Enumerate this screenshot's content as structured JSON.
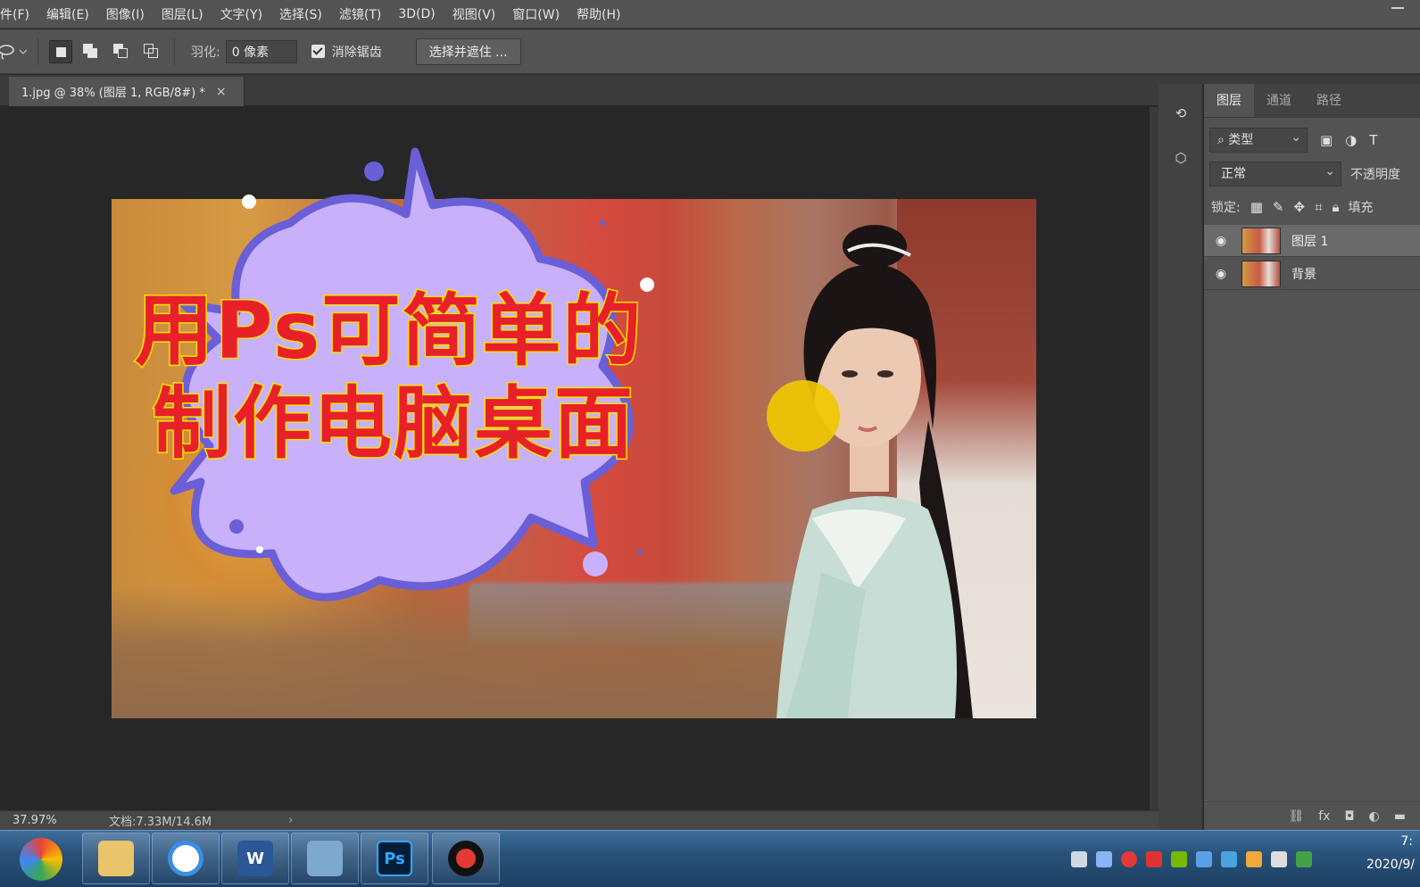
{
  "menu": [
    "件(F)",
    "编辑(E)",
    "图像(I)",
    "图层(L)",
    "文字(Y)",
    "选择(S)",
    "滤镜(T)",
    "3D(D)",
    "视图(V)",
    "窗口(W)",
    "帮助(H)"
  ],
  "options": {
    "feather_label": "羽化:",
    "feather_value": "0 像素",
    "antialias_label": "消除锯齿",
    "select_mask_label": "选择并遮住 ..."
  },
  "document": {
    "tab_title": "1.jpg @ 38% (图层 1, RGB/8#) *",
    "close_glyph": "×",
    "zoom": "37.97%",
    "doc_info": "文档:7.33M/14.6M",
    "status_arrow": "›"
  },
  "image_text": {
    "line1": "用Ps可简单的",
    "line2": "制作电脑桌面"
  },
  "layers_panel": {
    "tabs": [
      "图层",
      "通道",
      "路径"
    ],
    "filter_label": "类型",
    "blend_mode": "正常",
    "opacity_label": "不透明度",
    "lock_label": "锁定:",
    "fill_label": "填充",
    "layers": [
      {
        "name": "图层 1",
        "visible": true,
        "selected": true
      },
      {
        "name": "背景",
        "visible": true,
        "selected": false
      }
    ]
  },
  "taskbar": {
    "apps": [
      "chrome-icon",
      "file-explorer-icon",
      "baidu-netdisk-icon",
      "word-icon",
      "remote-desktop-icon",
      "photoshop-icon",
      "record-icon"
    ],
    "ps_label": "Ps",
    "word_label": "W",
    "time": "7:",
    "date": "2020/9/"
  },
  "colors": {
    "ps_bg": "#535353",
    "title_red": "#e8202a",
    "title_yellow_outline": "#f7e300",
    "sticker_fill": "#c8b0fb",
    "sticker_outline": "#6a5fd6",
    "highlight_yellow": "#f0c800"
  }
}
